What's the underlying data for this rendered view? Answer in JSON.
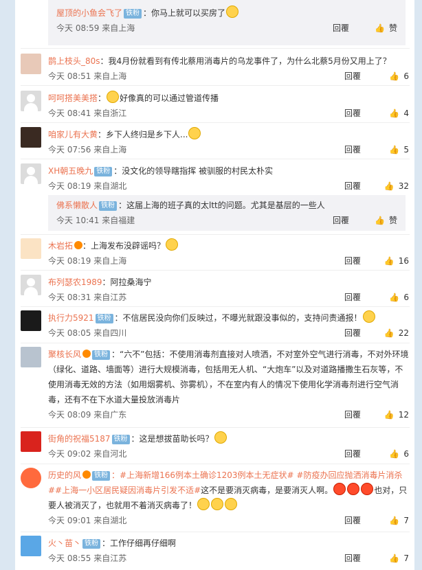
{
  "labels": {
    "reply": "回覆",
    "follow_badge": "铁粉"
  },
  "comments": [
    {
      "id": "c1",
      "user": "屋顶的小鱼会飞了",
      "badge": "铁粉",
      "text": "：你马上就可以买房了",
      "time": "今天 08:59 来自上海",
      "reply": "回覆",
      "likes": "",
      "like_glyph": "赞",
      "is_reply": true
    },
    {
      "id": "c2",
      "user": "鹊上枝头_80s",
      "badge": "",
      "text": "：我4月份就看到有传北蔡用消毒片的乌龙事件了，为什么北蔡5月份又用上了？",
      "time": "今天 08:51 来自上海",
      "reply": "回覆",
      "likes": "6"
    },
    {
      "id": "c3",
      "user": "呵呵搭美美搭",
      "badge": "",
      "text": "好像真的可以通过管道传播",
      "time": "今天 08:41 来自浙江",
      "reply": "回覆",
      "likes": "4"
    },
    {
      "id": "c4",
      "user": "咱家儿有大黄",
      "badge": "",
      "text": "：乡下人终归是乡下人...",
      "time": "今天 07:56 来自上海",
      "reply": "回覆",
      "likes": "5"
    },
    {
      "id": "c5",
      "user": "XH朝五晚九",
      "badge": "铁粉",
      "text": "：没文化的领导瞎指挥 被驯服的村民太朴实",
      "time": "今天 08:19 来自湖北",
      "reply": "回覆",
      "likes": "32"
    },
    {
      "id": "c6",
      "user": "佛系懒散人",
      "badge": "铁粉",
      "text": "：这届上海的班子真的太ltt的问题。尤其是基层的一些人",
      "time": "今天 10:41 来自福建",
      "reply": "回覆",
      "likes": "",
      "like_glyph": "赞",
      "is_reply": true
    },
    {
      "id": "c7",
      "user": "木岩拓",
      "badge": "",
      "text": "：上海发布没辟谣吗？",
      "time": "今天 08:19 来自上海",
      "reply": "回覆",
      "likes": "16"
    },
    {
      "id": "c8",
      "user": "布列瑟农1989",
      "badge": "",
      "text": "：阿拉桑海宁",
      "time": "今天 08:31 来自江苏",
      "reply": "回覆",
      "likes": "6"
    },
    {
      "id": "c9",
      "user": "执行力5921",
      "badge": "铁粉",
      "text": "：不信居民没向你们反映过，不曝光就跟没事似的，支持问责通报！",
      "time": "今天 08:05 来自四川",
      "reply": "回覆",
      "likes": "22"
    },
    {
      "id": "c10",
      "user": "聚核长风",
      "badge": "铁粉",
      "text": "：“六不”包括：不使用消毒剂直接对人喷洒，不对室外空气进行消毒，不对外环境（绿化、道路、墙面等）进行大规模消毒，包括用无人机、“大炮车”以及对道路播撒生石灰等，不使用消毒无效的方法（如用烟雾机、弥雾机），不在室内有人的情况下使用化学消毒剂进行空气消毒，还有不在下水道大量投放消毒片",
      "time": "今天 08:09 来自广东",
      "reply": "回覆",
      "likes": "12"
    },
    {
      "id": "c11",
      "user": "街角的祝福5187",
      "badge": "铁粉",
      "text": "：这是想拔苗助长吗？",
      "time": "今天 09:02 来自河北",
      "reply": "回覆",
      "likes": "6"
    },
    {
      "id": "c12",
      "user": "历史的风",
      "badge": "铁粉",
      "topic": "：#上海新增166例本土确诊1203例本土无症状# #防疫办回应抛洒消毒片消杀##上海一小区居民疑因消毒片引发不适#",
      "text": "这不是要消灭病毒，是要消灭人啊。",
      "text2": "也对，只要人被消灭了，也就用不着消灭病毒了！",
      "time": "今天 09:01 来自湖北",
      "reply": "回覆",
      "likes": "7"
    },
    {
      "id": "c13",
      "user": "火丶苗丶",
      "badge": "铁粉",
      "text": "工作仔细再仔细啊",
      "time": "今天 08:55 来自江苏",
      "reply": "回覆",
      "likes": "7"
    }
  ]
}
